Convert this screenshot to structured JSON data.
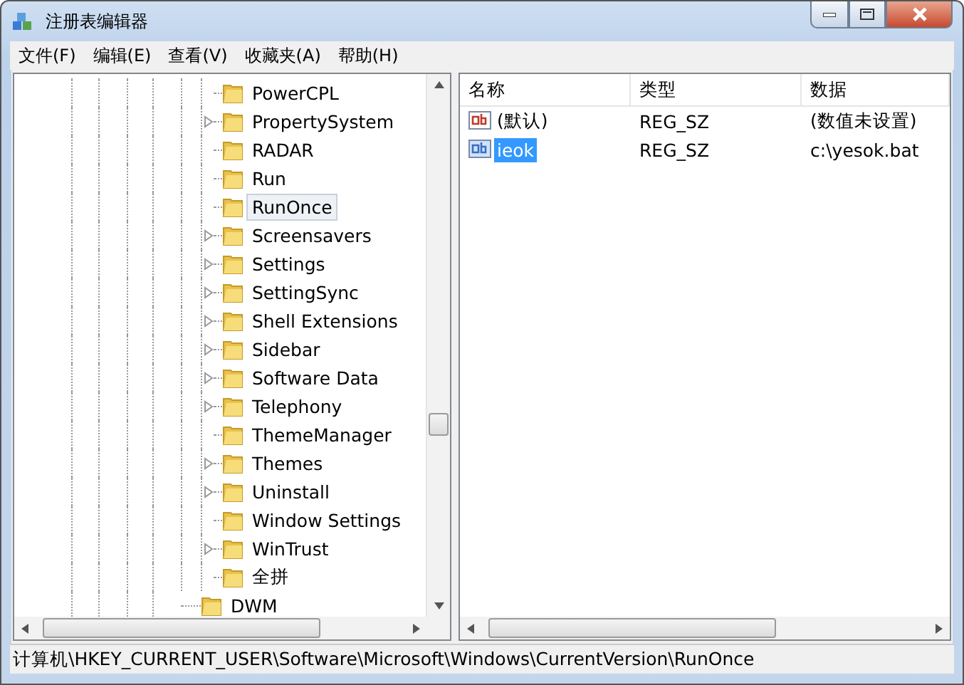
{
  "window": {
    "title": "注册表编辑器"
  },
  "menu": [
    {
      "label": "文件(F)"
    },
    {
      "label": "编辑(E)"
    },
    {
      "label": "查看(V)"
    },
    {
      "label": "收藏夹(A)"
    },
    {
      "label": "帮助(H)"
    }
  ],
  "tree": {
    "nodes": [
      {
        "children": [
          {
            "label": "PowerCPL",
            "expandable": false,
            "selected": false
          },
          {
            "label": "PropertySystem",
            "expandable": true,
            "selected": false
          },
          {
            "label": "RADAR",
            "expandable": false,
            "selected": false
          },
          {
            "label": "Run",
            "expandable": false,
            "selected": false
          },
          {
            "label": "RunOnce",
            "expandable": false,
            "selected": true
          },
          {
            "label": "Screensavers",
            "expandable": true,
            "selected": false
          },
          {
            "label": "Settings",
            "expandable": true,
            "selected": false
          },
          {
            "label": "SettingSync",
            "expandable": true,
            "selected": false
          },
          {
            "label": "Shell Extensions",
            "expandable": true,
            "selected": false
          },
          {
            "label": "Sidebar",
            "expandable": true,
            "selected": false
          },
          {
            "label": "Software Data",
            "expandable": true,
            "selected": false
          },
          {
            "label": "Telephony",
            "expandable": true,
            "selected": false
          },
          {
            "label": "ThemeManager",
            "expandable": false,
            "selected": false
          },
          {
            "label": "Themes",
            "expandable": true,
            "selected": false
          },
          {
            "label": "Uninstall",
            "expandable": true,
            "selected": false
          },
          {
            "label": "Window Settings",
            "expandable": false,
            "selected": false
          },
          {
            "label": "WinTrust",
            "expandable": true,
            "selected": false
          },
          {
            "label": "全拼",
            "expandable": false,
            "selected": false
          }
        ]
      },
      {
        "label": "DWM",
        "selected": false
      }
    ]
  },
  "values": {
    "columns": [
      "名称",
      "类型",
      "数据"
    ],
    "rows": [
      {
        "name": "(默认)",
        "type": "REG_SZ",
        "data": "(数值未设置)",
        "selected": false
      },
      {
        "name": "ieok",
        "type": "REG_SZ",
        "data": "c:\\yesok.bat",
        "selected": true
      }
    ]
  },
  "status_bar": "计算机\\HKEY_CURRENT_USER\\Software\\Microsoft\\Windows\\CurrentVersion\\RunOnce"
}
